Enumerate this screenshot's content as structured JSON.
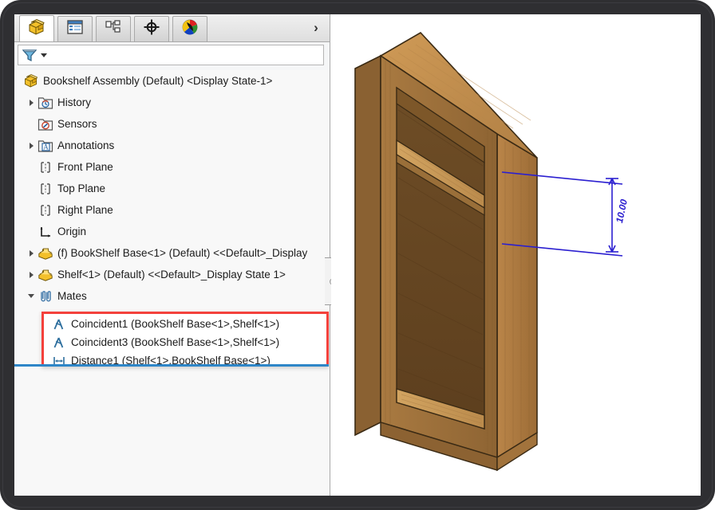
{
  "window": {
    "frame_color": "#2f2f32"
  },
  "panel": {
    "tabs": [
      {
        "name": "feature-manager-design-tree",
        "icon": "yellow-assembly-cube-icon",
        "active": true
      },
      {
        "name": "property-manager",
        "icon": "property-list-icon",
        "active": false
      },
      {
        "name": "configuration-manager",
        "icon": "configuration-tree-icon",
        "active": false
      },
      {
        "name": "dimxpert-manager",
        "icon": "crosshair-target-icon",
        "active": false
      },
      {
        "name": "display-manager",
        "icon": "color-sphere-icon",
        "active": false
      }
    ],
    "expand_arrow_glyph": "›",
    "filter": {
      "icon": "filter-funnel-icon",
      "placeholder": "",
      "value": ""
    }
  },
  "tree": {
    "root": {
      "label": "Bookshelf Assembly (Default) <Display State-1>",
      "icon": "assembly-cube-icon"
    },
    "items": [
      {
        "label": "History",
        "icon": "history-folder-icon",
        "indent": 1,
        "arrow": "right",
        "selected": false
      },
      {
        "label": "Sensors",
        "icon": "sensors-folder-icon",
        "indent": 1,
        "arrow": "none",
        "selected": false
      },
      {
        "label": "Annotations",
        "icon": "annotations-folder-icon",
        "indent": 1,
        "arrow": "right",
        "selected": false
      },
      {
        "label": "Front Plane",
        "icon": "plane-icon",
        "indent": 1,
        "arrow": "none",
        "selected": false
      },
      {
        "label": "Top Plane",
        "icon": "plane-icon",
        "indent": 1,
        "arrow": "none",
        "selected": false
      },
      {
        "label": "Right Plane",
        "icon": "plane-icon",
        "indent": 1,
        "arrow": "none",
        "selected": false
      },
      {
        "label": "Origin",
        "icon": "origin-axes-icon",
        "indent": 1,
        "arrow": "none",
        "selected": false
      },
      {
        "label": "(f) BookShelf Base<1>  (Default) <<Default>_Display",
        "icon": "part-icon",
        "indent": 1,
        "arrow": "right",
        "selected": false
      },
      {
        "label": "Shelf<1>  (Default) <<Default>_Display State 1>",
        "icon": "part-icon",
        "indent": 1,
        "arrow": "right",
        "selected": false
      },
      {
        "label": "Mates",
        "icon": "mates-paperclip-icon",
        "indent": 1,
        "arrow": "down",
        "selected": false
      }
    ],
    "mates": [
      {
        "label": "Coincident1 (BookShelf Base<1>,Shelf<1>)",
        "icon": "coincident-mate-icon"
      },
      {
        "label": "Coincident3 (BookShelf Base<1>,Shelf<1>)",
        "icon": "coincident-mate-icon"
      },
      {
        "label": "Distance1 (Shelf<1>,BookShelf Base<1>)",
        "icon": "distance-mate-icon"
      }
    ],
    "highlight_color": "#f4413c",
    "underline_color": "#2e86c8"
  },
  "graphics": {
    "model_name": "bookshelf-assembly-3d-model",
    "dimension": {
      "value": "10.00",
      "color": "#2b1fd0"
    },
    "wood_colors": {
      "top_face": "#c08f4f",
      "front_face": "#9b6f38",
      "side_face": "#b07f45",
      "inner_back": "#6b4a24",
      "shelf_top": "#c99a58",
      "edge": "#3a2a14"
    }
  }
}
